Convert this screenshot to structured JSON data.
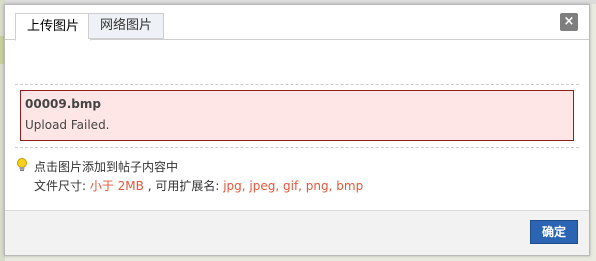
{
  "tabs": [
    {
      "label": "上传图片",
      "active": true
    },
    {
      "label": "网络图片",
      "active": false
    }
  ],
  "close": {
    "glyph": "×"
  },
  "upload": {
    "filename": "00009.bmp",
    "status": "Upload Failed."
  },
  "tips": {
    "line1": "点击图片添加到帖子内容中",
    "size_prefix": "文件尺寸: ",
    "size_value": "小于 2MB",
    "ext_prefix": " , 可用扩展名: ",
    "ext_value": "jpg, jpeg, gif, png, bmp"
  },
  "footer": {
    "ok_label": "确定"
  },
  "colors": {
    "accent": "#2a64b3",
    "error_border": "#8e1f1f",
    "error_bg": "#fee6e6",
    "highlight": "#e2573a"
  },
  "icons": {
    "tip": "lightbulb-icon",
    "close": "close-icon"
  }
}
